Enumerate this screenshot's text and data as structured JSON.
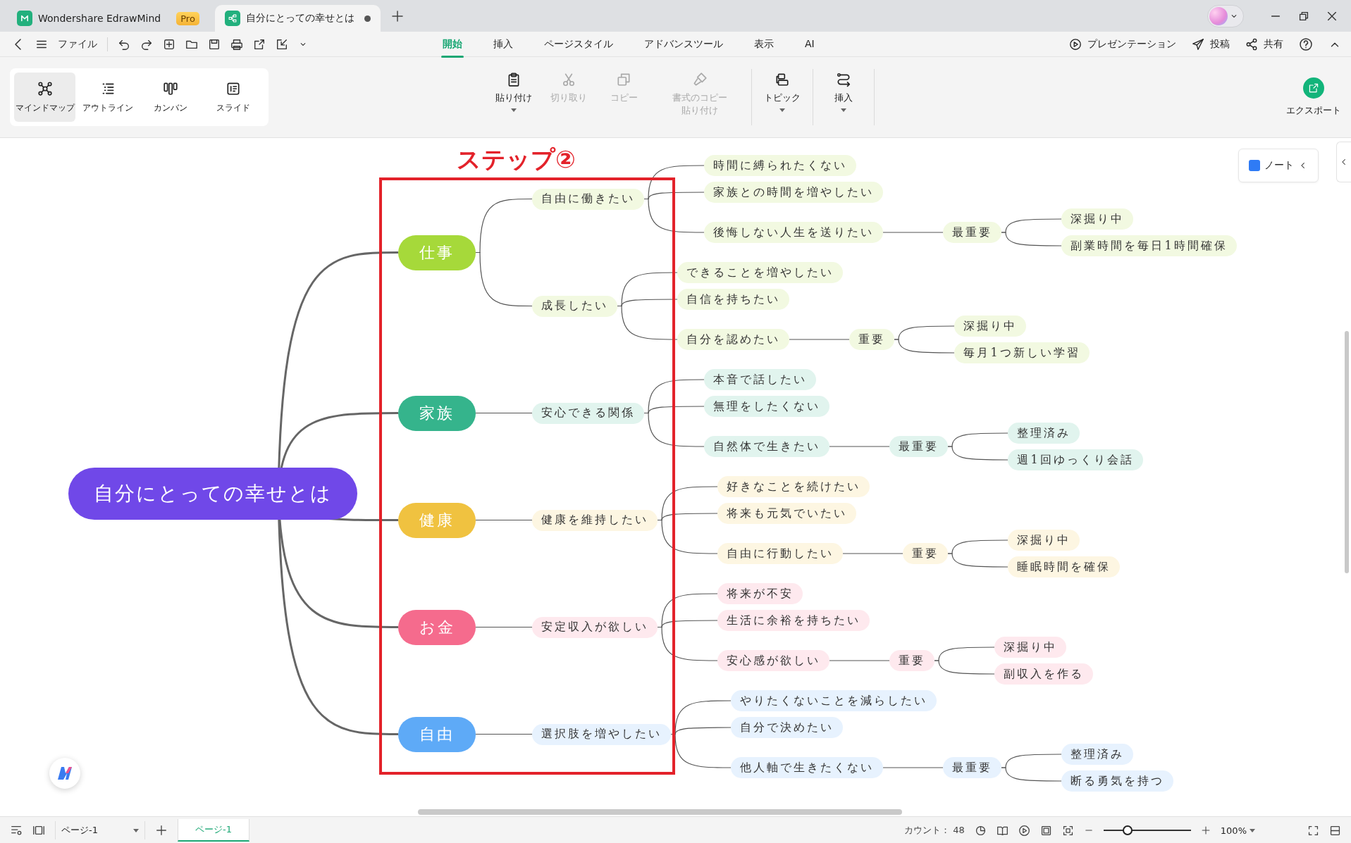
{
  "window_tabs": [
    {
      "kind": "home",
      "title": "Wondershare EdrawMind",
      "badge": "Pro",
      "selected": false,
      "unsaved": false
    },
    {
      "kind": "doc",
      "title": "自分にとっての幸せとは",
      "selected": true,
      "unsaved": true
    }
  ],
  "menu_bar": {
    "file": "ファイル",
    "tabs": [
      {
        "label": "開始",
        "selected": true
      },
      {
        "label": "挿入",
        "selected": false
      },
      {
        "label": "ページスタイル",
        "selected": false
      },
      {
        "label": "アドバンスツール",
        "selected": false
      },
      {
        "label": "表示",
        "selected": false
      },
      {
        "label": "AI",
        "selected": false
      }
    ],
    "actions": [
      {
        "kind": "present",
        "label": "プレゼンテーション"
      },
      {
        "kind": "post",
        "label": "投稿"
      },
      {
        "kind": "share",
        "label": "共有"
      }
    ]
  },
  "views": [
    {
      "kind": "mindmap",
      "label": "マインドマップ",
      "selected": true
    },
    {
      "kind": "outline",
      "label": "アウトライン",
      "selected": false
    },
    {
      "kind": "kanban",
      "label": "カンバン",
      "selected": false
    },
    {
      "kind": "slide",
      "label": "スライド",
      "selected": false
    }
  ],
  "ribbon": [
    {
      "kind": "paste",
      "label": "貼り付け",
      "disabled": false,
      "dropdown": true
    },
    {
      "kind": "cut",
      "label": "切り取り",
      "disabled": true,
      "dropdown": false
    },
    {
      "kind": "copy",
      "label": "コピー",
      "disabled": true,
      "dropdown": false
    },
    {
      "kind": "format",
      "label": "書式のコピー貼り付け",
      "disabled": true,
      "dropdown": false
    },
    {
      "kind": "topic",
      "label": "トピック",
      "disabled": false,
      "dropdown": true
    },
    {
      "kind": "insert",
      "label": "挿入",
      "disabled": false,
      "dropdown": true
    }
  ],
  "export_button": "エクスポート",
  "note_button": "ノート",
  "annotation": {
    "title": "ステップ②"
  },
  "mindmap": {
    "root": "自分にとっての幸せとは",
    "branches": [
      {
        "title": "仕事",
        "color": "#a6d93a",
        "children": [
          {
            "title": "自由に働きたい",
            "children": [
              {
                "title": "時間に縛られたくない"
              },
              {
                "title": "家族との時間を増やしたい"
              },
              {
                "title": "後悔しない人生を送りたい",
                "children": [
                  {
                    "title": "最重要",
                    "children": [
                      {
                        "title": "深掘り中"
                      },
                      {
                        "title": "副業時間を毎日1時間確保"
                      }
                    ]
                  }
                ]
              }
            ]
          },
          {
            "title": "成長したい",
            "children": [
              {
                "title": "できることを増やしたい"
              },
              {
                "title": "自信を持ちたい"
              },
              {
                "title": "自分を認めたい",
                "children": [
                  {
                    "title": "重要",
                    "children": [
                      {
                        "title": "深掘り中"
                      },
                      {
                        "title": "毎月1つ新しい学習"
                      }
                    ]
                  }
                ]
              }
            ]
          }
        ]
      },
      {
        "title": "家族",
        "color": "#35b48c",
        "children": [
          {
            "title": "安心できる関係",
            "children": [
              {
                "title": "本音で話したい"
              },
              {
                "title": "無理をしたくない"
              },
              {
                "title": "自然体で生きたい",
                "children": [
                  {
                    "title": "最重要",
                    "children": [
                      {
                        "title": "整理済み"
                      },
                      {
                        "title": "週1回ゆっくり会話"
                      }
                    ]
                  }
                ]
              }
            ]
          }
        ]
      },
      {
        "title": "健康",
        "color": "#f0c240",
        "children": [
          {
            "title": "健康を維持したい",
            "children": [
              {
                "title": "好きなことを続けたい"
              },
              {
                "title": "将来も元気でいたい"
              },
              {
                "title": "自由に行動したい",
                "children": [
                  {
                    "title": "重要",
                    "children": [
                      {
                        "title": "深掘り中"
                      },
                      {
                        "title": "睡眠時間を確保"
                      }
                    ]
                  }
                ]
              }
            ]
          }
        ]
      },
      {
        "title": "お金",
        "color": "#f56b8d",
        "children": [
          {
            "title": "安定収入が欲しい",
            "children": [
              {
                "title": "将来が不安"
              },
              {
                "title": "生活に余裕を持ちたい"
              },
              {
                "title": "安心感が欲しい",
                "children": [
                  {
                    "title": "重要",
                    "children": [
                      {
                        "title": "深掘り中"
                      },
                      {
                        "title": "副収入を作る"
                      }
                    ]
                  }
                ]
              }
            ]
          }
        ]
      },
      {
        "title": "自由",
        "color": "#5eaaf7",
        "children": [
          {
            "title": "選択肢を増やしたい",
            "children": [
              {
                "title": "やりたくないことを減らしたい"
              },
              {
                "title": "自分で決めたい"
              },
              {
                "title": "他人軸で生きたくない",
                "children": [
                  {
                    "title": "最重要",
                    "children": [
                      {
                        "title": "整理済み"
                      },
                      {
                        "title": "断る勇気を持つ"
                      }
                    ]
                  }
                ]
              }
            ]
          }
        ]
      }
    ]
  },
  "status_bar": {
    "page_select": "ページ-1",
    "page_tabs": [
      {
        "label": "ページ-1",
        "selected": true
      }
    ],
    "count": "カウント： 48",
    "zoom": {
      "level": 0.25,
      "reading": "100%"
    }
  }
}
